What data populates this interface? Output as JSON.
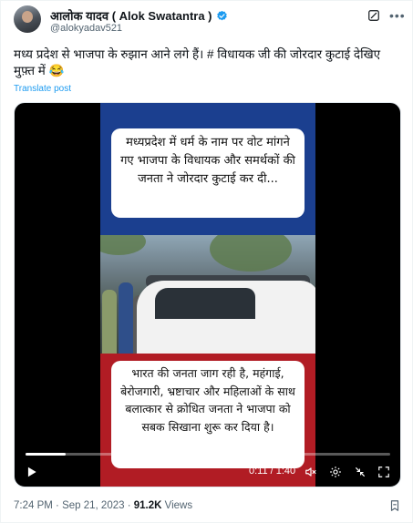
{
  "author": {
    "display_name": "आलोक यादव ( Alok Swatantra )",
    "handle": "@alokyadav521"
  },
  "tweet": {
    "text": "मध्य प्रदेश से भाजपा के रुझान आने लगे हैं। #  विधायक जी की जोरदार कुटाई देखिए मुफ़्त में 😂",
    "translate_label": "Translate post"
  },
  "video": {
    "caption_top": "मध्यप्रदेश में धर्म के नाम पर वोट मांगने गए भाजपा के विधायक और समर्थकों की जनता ने जोरदार कुटाई कर दी...",
    "caption_bottom": "भारत की जनता जाग रही है, महंगाई, बेरोजगारी, भ्रष्टाचार और महिलाओं के साथ बलात्कार से क्रोधित जनता ने भाजपा को सबक सिखाना शुरू कर दिया है।",
    "time_display": "0:11 / 1:40",
    "progress_fraction": 0.11,
    "panel_colors": {
      "top": "#1b3f8f",
      "bottom": "#b11c24"
    }
  },
  "meta": {
    "time": "7:24 PM",
    "date": "Sep 21, 2023",
    "views_count": "91.2K",
    "views_label": "Views",
    "separator": "·"
  },
  "icons": {
    "verified": "verified-badge-icon",
    "grok": "grok-icon",
    "more": "more-options-icon",
    "play": "play-icon",
    "mute": "volume-muted-icon",
    "settings": "settings-gear-icon",
    "fullscreen_exit": "collapse-icon",
    "fullscreen": "fullscreen-icon",
    "bookmark": "bookmark-icon"
  },
  "colors": {
    "link": "#1d9bf0",
    "muted": "#536471",
    "verified": "#1d9bf0"
  }
}
